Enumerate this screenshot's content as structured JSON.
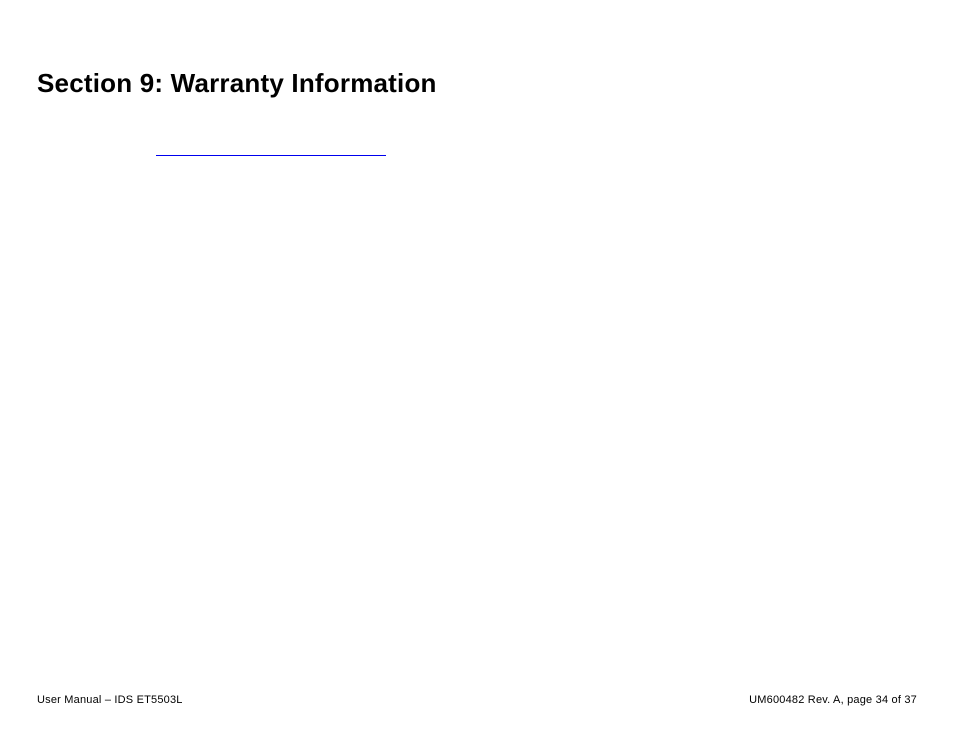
{
  "heading": "Section 9: Warranty Information",
  "link": {
    "text": "",
    "underline_color": "#0000EE"
  },
  "footer": {
    "left": "User Manual – IDS ET5503L",
    "right": "UM600482 Rev. A, page 34 of 37"
  }
}
